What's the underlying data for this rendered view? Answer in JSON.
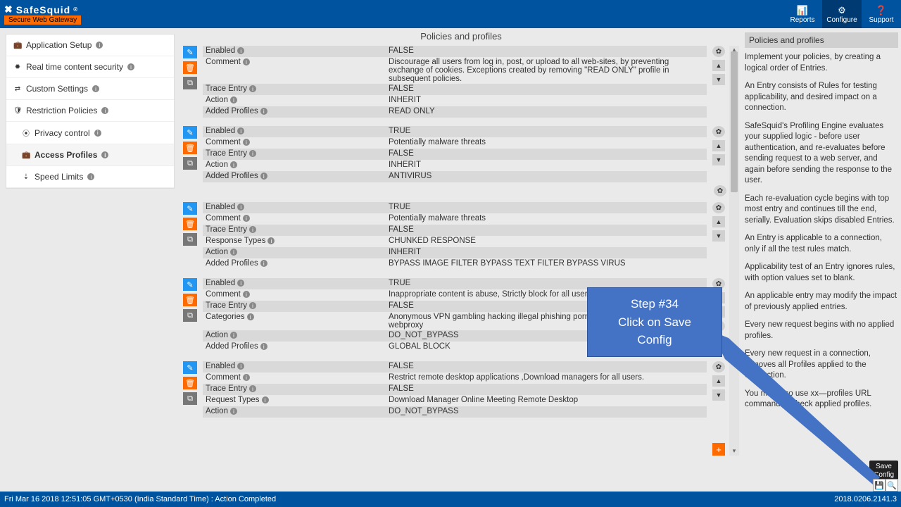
{
  "brand": {
    "name": "SafeSquid",
    "reg": "®",
    "tagline": "Secure Web Gateway"
  },
  "topnav": {
    "reports": "Reports",
    "configure": "Configure",
    "support": "Support"
  },
  "sidebar": {
    "items": [
      {
        "icon": "💼",
        "label": "Application Setup"
      },
      {
        "icon": "✹",
        "label": "Real time content security"
      },
      {
        "icon": "⇄",
        "label": "Custom Settings"
      },
      {
        "icon": "🛡",
        "label": "Restriction Policies"
      },
      {
        "icon": "⦿",
        "label": "Privacy control",
        "sub": true
      },
      {
        "icon": "💼",
        "label": "Access Profiles",
        "sub": true,
        "active": true
      },
      {
        "icon": "⇣",
        "label": "Speed Limits",
        "sub": true
      }
    ]
  },
  "main_title": "Policies and profiles",
  "labels": {
    "enabled": "Enabled",
    "comment": "Comment",
    "trace": "Trace Entry",
    "action": "Action",
    "added": "Added Profiles",
    "response": "Response Types",
    "categories": "Categories",
    "request": "Request Types"
  },
  "entries": [
    {
      "rows": [
        {
          "k": "enabled",
          "v": "FALSE",
          "alt": true,
          "gear": true
        },
        {
          "k": "comment",
          "v": "Discourage all users from log in, post, or upload to all web-sites, by preventing exchange of cookies.\nExceptions created by removing \"READ ONLY\" profile in subsequent policies.",
          "up": true
        },
        {
          "k": "trace",
          "v": "FALSE",
          "alt": true,
          "down": true
        },
        {
          "k": "action",
          "v": "INHERIT"
        },
        {
          "k": "added",
          "v": "READ ONLY",
          "alt": true
        }
      ]
    },
    {
      "rows": [
        {
          "k": "enabled",
          "v": "TRUE",
          "alt": true,
          "gear": true
        },
        {
          "k": "comment",
          "v": "Potentially malware threats",
          "up": true
        },
        {
          "k": "trace",
          "v": "FALSE",
          "alt": true,
          "down": true
        },
        {
          "k": "action",
          "v": "INHERIT"
        },
        {
          "k": "added",
          "v": "ANTIVIRUS",
          "alt": true
        }
      ],
      "extra_gear": true
    },
    {
      "rows": [
        {
          "k": "enabled",
          "v": "TRUE",
          "alt": true,
          "gear": true
        },
        {
          "k": "comment",
          "v": "Potentially malware threats",
          "up": true
        },
        {
          "k": "trace",
          "v": "FALSE",
          "alt": true,
          "down": true
        },
        {
          "k": "response",
          "v": "CHUNKED RESPONSE"
        },
        {
          "k": "action",
          "v": "INHERIT",
          "alt": true
        },
        {
          "k": "added",
          "v": "BYPASS IMAGE FILTER   BYPASS TEXT FILTER   BYPASS VIRUS"
        }
      ]
    },
    {
      "rows": [
        {
          "k": "enabled",
          "v": "TRUE",
          "alt": true,
          "gear": true
        },
        {
          "k": "comment",
          "v": "Inappropriate content is abuse, Strictly block for all users.",
          "up": true
        },
        {
          "k": "trace",
          "v": "FALSE",
          "alt": true,
          "down": true
        },
        {
          "k": "categories",
          "v": "Anonymous VPN   gambling   hacking   illegal   phishing   pornography   violence   virusinfected   webproxy"
        },
        {
          "k": "action",
          "v": "DO_NOT_BYPASS",
          "alt": true,
          "gear2": true
        },
        {
          "k": "added",
          "v": "GLOBAL BLOCK"
        }
      ]
    },
    {
      "rows": [
        {
          "k": "enabled",
          "v": "FALSE",
          "alt": true,
          "gear": true
        },
        {
          "k": "comment",
          "v": "Restrict remote desktop applications ,Download managers for all users.",
          "up": true
        },
        {
          "k": "trace",
          "v": "FALSE",
          "alt": true,
          "down": true
        },
        {
          "k": "request",
          "v": "Download Manager   Online Meeting   Remote Desktop"
        },
        {
          "k": "action",
          "v": "DO_NOT_BYPASS",
          "alt": true
        }
      ]
    }
  ],
  "right": {
    "title": "Policies and profiles",
    "paras": [
      "Implement your policies, by creating a logical order of Entries.",
      "An Entry consists of Rules for testing applicability, and desired impact on a connection.",
      "SafeSquid's Profiling Engine evaluates your supplied logic - before user authentication, and re-evaluates before sending request to a web server, and again before sending the response to the user.",
      "Each re-evaluation cycle begins with top most entry and continues till the end, serially. Evaluation skips disabled Entries.",
      "An Entry is applicable to a connection, only if all the test rules match.",
      "Applicability test of an Entry ignores rules, with option values set to blank.",
      "An applicable entry may modify the impact of previously applied entries.",
      "Every new request begins with no applied profiles.",
      "Every new request in a connection, removes all Profiles applied to the connection.",
      "You may also use xx—profiles URL command to check applied profiles."
    ]
  },
  "callout": {
    "l1": "Step #34",
    "l2": "Click on Save",
    "l3": "Config"
  },
  "tooltip": {
    "l1": "Save",
    "l2": "Config"
  },
  "footer": {
    "left": "Fri Mar 16 2018 12:51:05 GMT+0530 (India Standard Time) : Action Completed",
    "right": "2018.0206.2141.3"
  }
}
